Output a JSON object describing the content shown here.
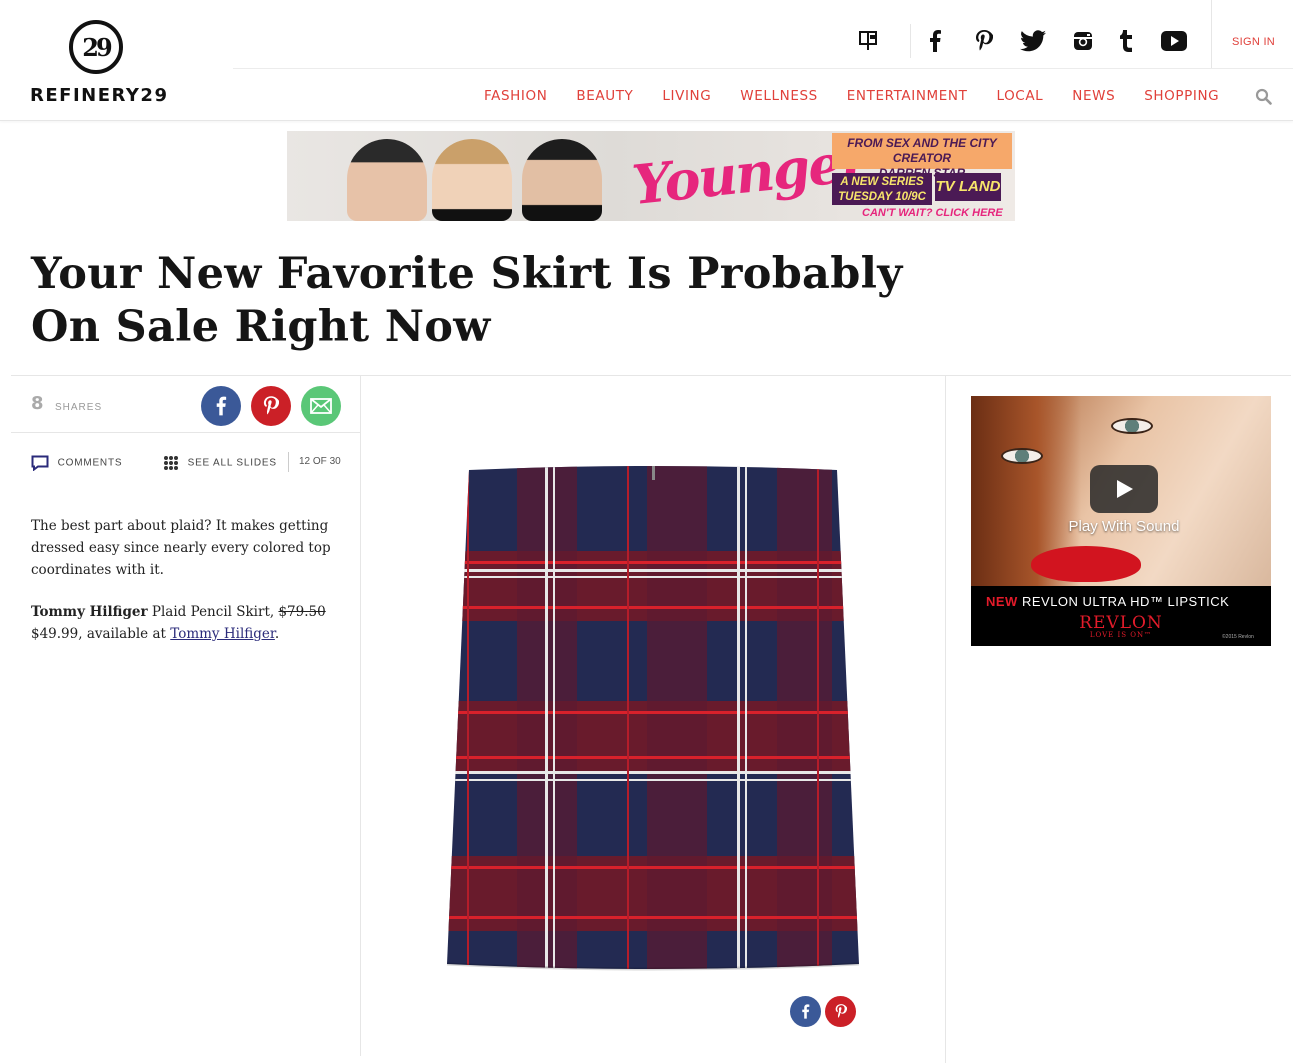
{
  "brand": {
    "logo_mark": "29",
    "logo_text": "REFINERY29"
  },
  "header": {
    "social_icons": [
      "mail-icon",
      "facebook-icon",
      "pinterest-icon",
      "twitter-icon",
      "instagram-icon",
      "tumblr-icon",
      "youtube-icon"
    ],
    "sign_in": "SIGN IN",
    "nav": [
      "FASHION",
      "BEAUTY",
      "LIVING",
      "WELLNESS",
      "ENTERTAINMENT",
      "LOCAL",
      "NEWS",
      "SHOPPING"
    ],
    "accent_color": "#e0403a"
  },
  "banner_ad": {
    "script_title": "Younger",
    "line1": "FROM SEX AND THE CITY CREATOR",
    "line2": "DARREN STAR",
    "line3": "A NEW SERIES",
    "line4": "TUESDAY 10/9C",
    "network": "TV LAND",
    "cta": "CAN'T WAIT? CLICK HERE"
  },
  "article": {
    "title": "Your New Favorite Skirt Is Probably On Sale Right Now",
    "shares_count": "8",
    "shares_label": "SHARES",
    "comments_label": "COMMENTS",
    "see_all_label": "SEE ALL SLIDES",
    "slide_counter": "12 OF 30",
    "body": "The best part about plaid? It makes getting dressed easy since nearly every colored top coordinates with it.",
    "product": {
      "brand": "Tommy Hilfiger",
      "name": "Plaid Pencil Skirt,",
      "old_price": "$79.50",
      "new_price": "$49.99, available at",
      "retailer_link": "Tommy Hilfiger",
      "period": "."
    }
  },
  "side_ad": {
    "play_label": "Play With Sound",
    "new_label": "NEW",
    "product_line": "REVLON ULTRA HD™ LIPSTICK",
    "brand": "REVLON",
    "tagline": "LOVE IS ON™",
    "copyright": "©2015 Revlon"
  },
  "colors": {
    "facebook": "#3b5998",
    "pinterest": "#cb2027",
    "email": "#5ac777",
    "skirt_navy": "#232a52",
    "skirt_red": "#8b1d25"
  }
}
